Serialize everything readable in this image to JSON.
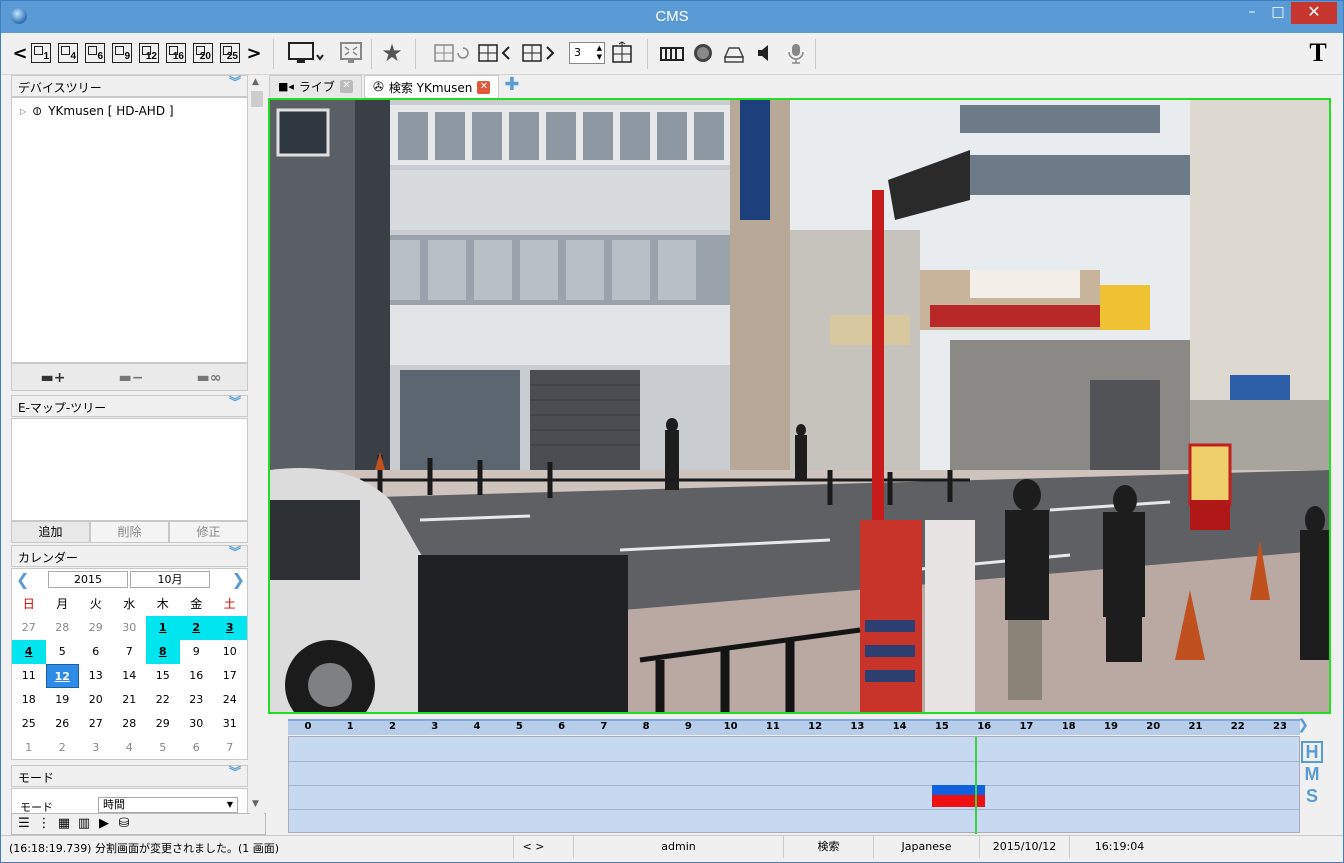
{
  "window": {
    "title": "CMS",
    "minimize": "–",
    "maximize": "□",
    "close": "✕"
  },
  "toolbar": {
    "prev": "<",
    "next": ">",
    "layouts": [
      "1",
      "4",
      "6",
      "9",
      "12",
      "16",
      "20",
      "25"
    ],
    "split_value": "3"
  },
  "left": {
    "device_tree": {
      "title": "デバイスツリー",
      "items": [
        {
          "label": "YKmusen [ HD-AHD ]"
        }
      ]
    },
    "emap": {
      "title": "E-マップ-ツリー",
      "add": "追加",
      "delete": "削除",
      "edit": "修正"
    },
    "calendar": {
      "title": "カレンダー",
      "year": "2015",
      "month": "10月",
      "weekdays": [
        "日",
        "月",
        "火",
        "水",
        "木",
        "金",
        "土"
      ],
      "weeks": [
        [
          "27",
          "28",
          "29",
          "30",
          "1",
          "2",
          "3"
        ],
        [
          "4",
          "5",
          "6",
          "7",
          "8",
          "9",
          "10"
        ],
        [
          "11",
          "12",
          "13",
          "14",
          "15",
          "16",
          "17"
        ],
        [
          "18",
          "19",
          "20",
          "21",
          "22",
          "23",
          "24"
        ],
        [
          "25",
          "26",
          "27",
          "28",
          "29",
          "30",
          "31"
        ],
        [
          "1",
          "2",
          "3",
          "4",
          "5",
          "6",
          "7"
        ]
      ],
      "recorded_days": [
        "1",
        "2",
        "3",
        "4",
        "8"
      ],
      "selected_day": "12"
    },
    "mode": {
      "title": "モード",
      "label": "モード",
      "value": "時間"
    }
  },
  "tabs": [
    {
      "label": "ライブ"
    },
    {
      "label": "検索 YKmusen"
    }
  ],
  "timeline": {
    "hours": [
      "0",
      "1",
      "2",
      "3",
      "4",
      "5",
      "6",
      "7",
      "8",
      "9",
      "10",
      "11",
      "12",
      "13",
      "14",
      "15",
      "16",
      "17",
      "18",
      "19",
      "20",
      "21",
      "22",
      "23"
    ],
    "cursor_hour": 16.0,
    "recording": {
      "start_hour": 15.0,
      "end_hour": 16.0
    },
    "hms": [
      "H",
      "M",
      "S"
    ]
  },
  "status": {
    "message": "(16:18:19.739) 分割画面が変更されました。(1 画面)",
    "nav": "<  >",
    "user": "admin",
    "mode": "検索",
    "language": "Japanese",
    "date": "2015/10/12",
    "time": "16:19:04"
  }
}
